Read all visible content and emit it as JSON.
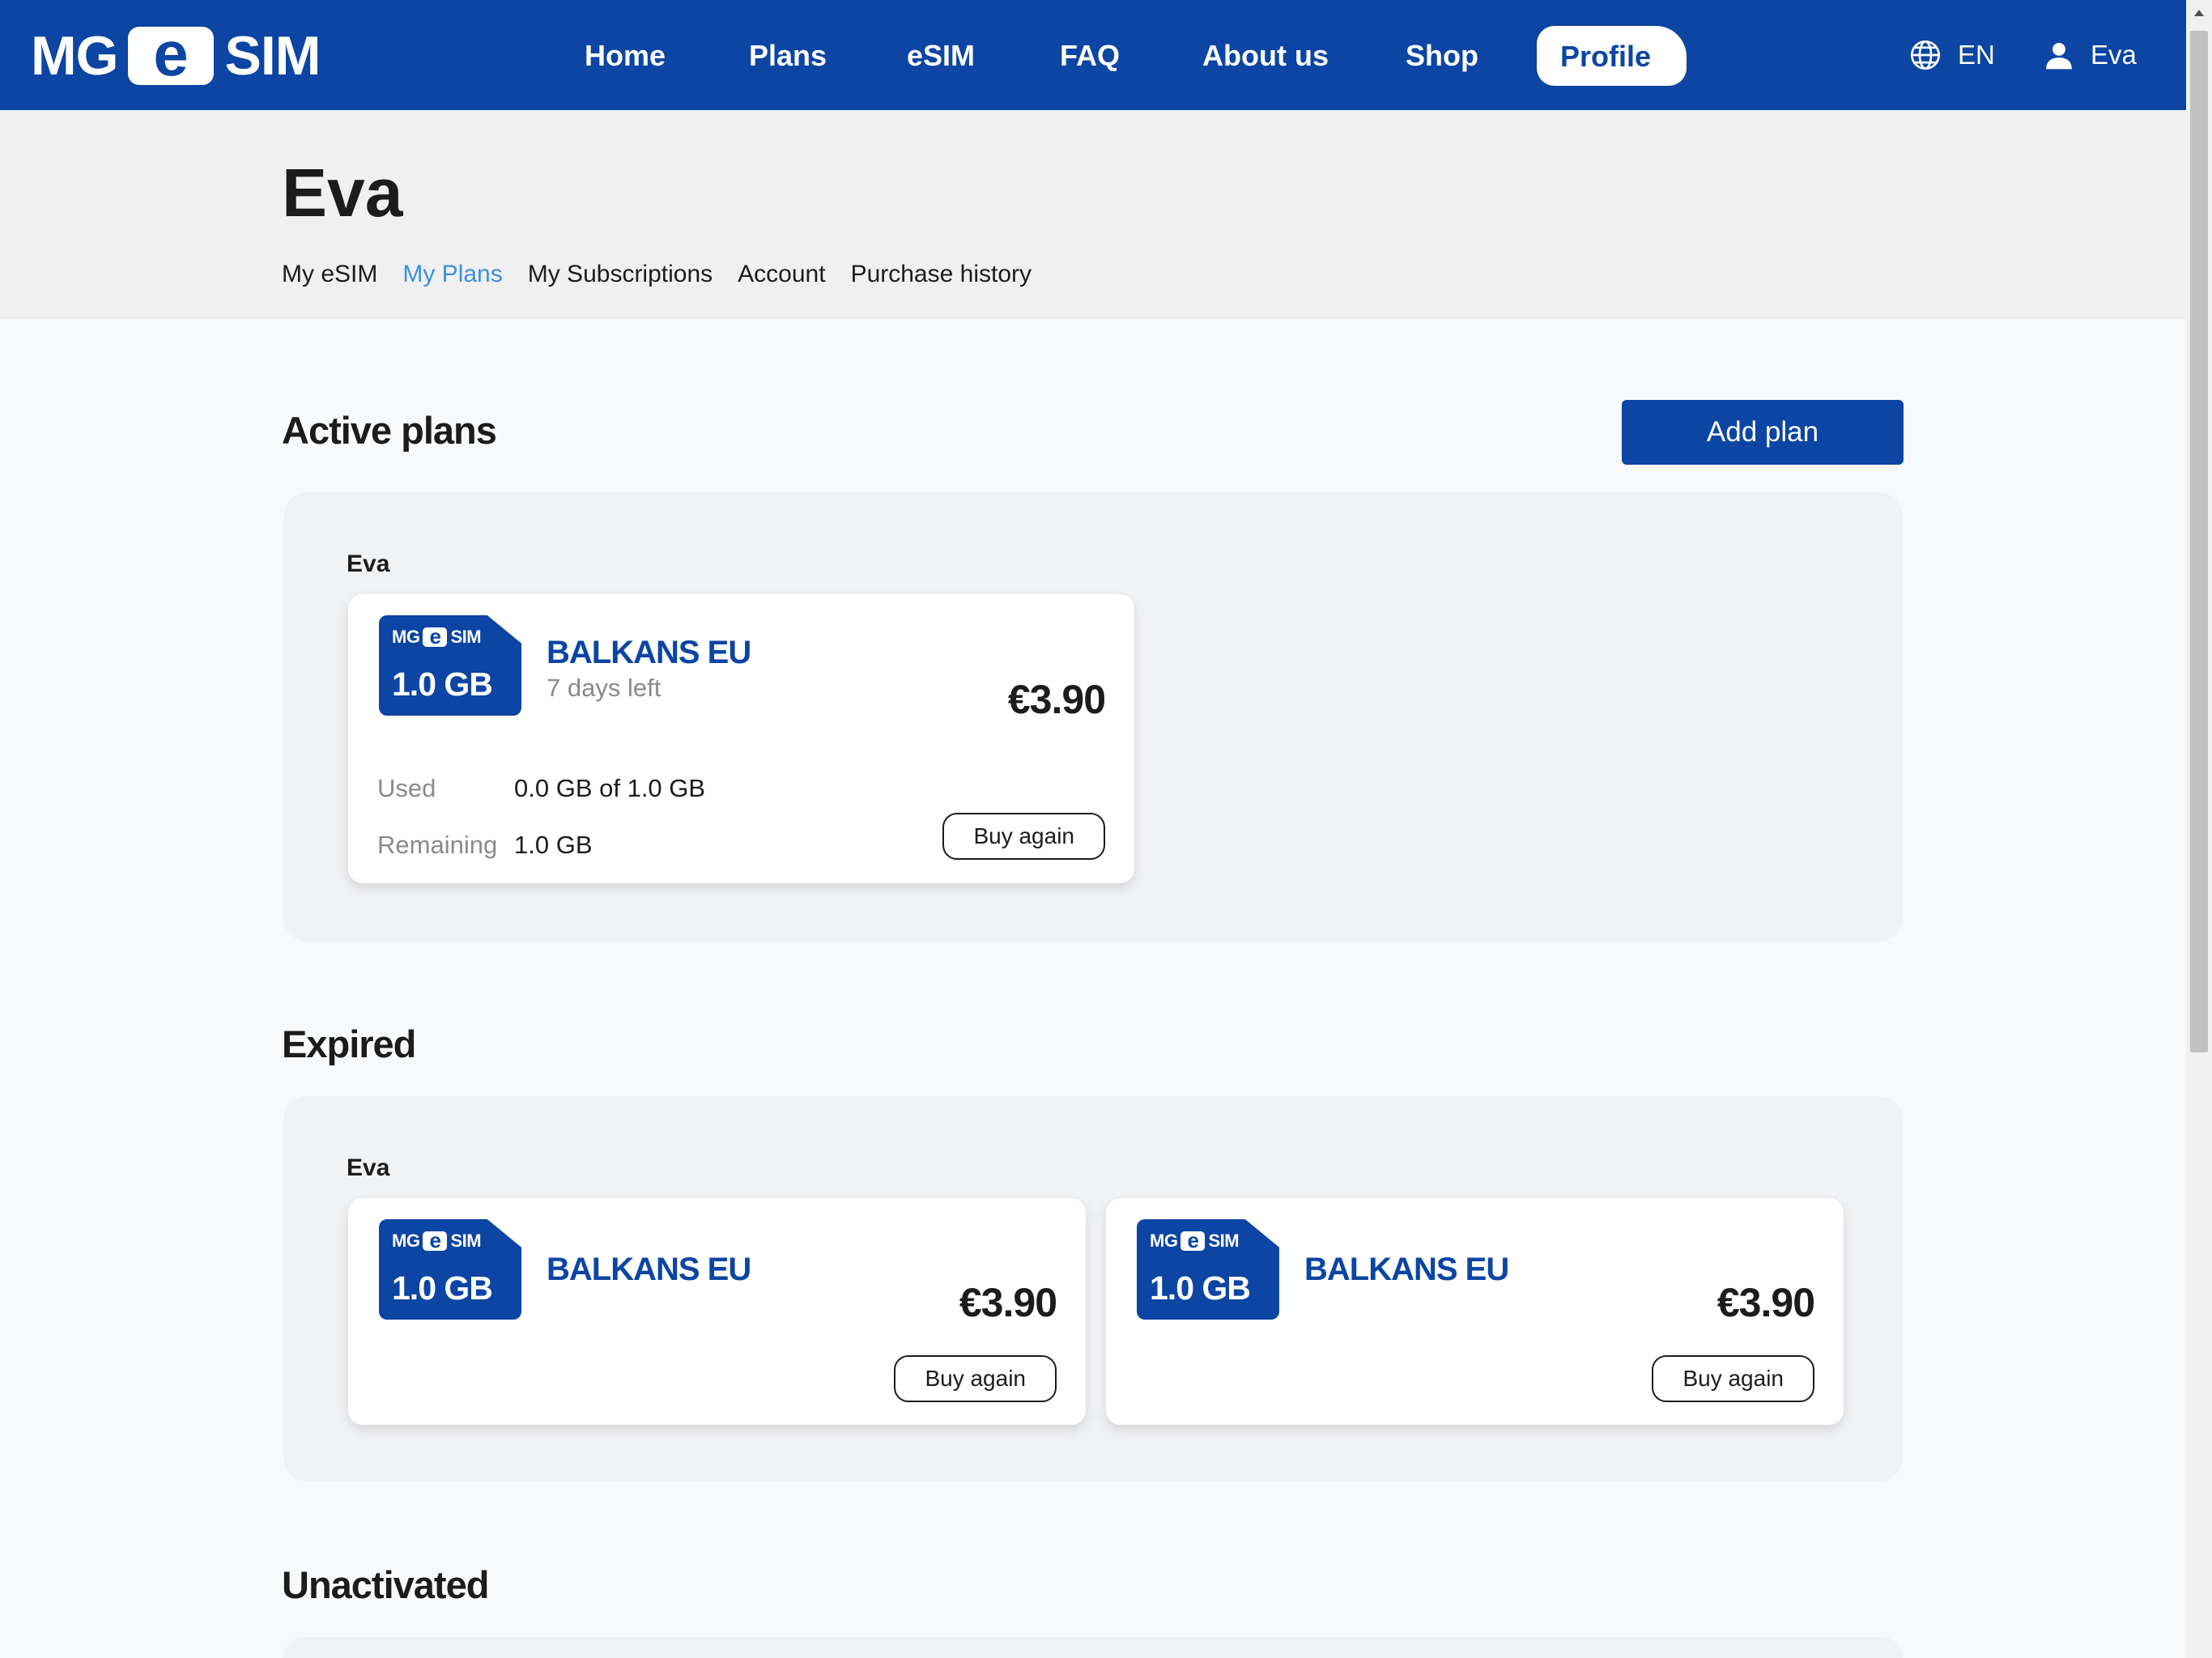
{
  "brand": {
    "logo_left": "MG",
    "logo_e": "e",
    "logo_right": "SIM"
  },
  "nav": {
    "items": [
      {
        "label": "Home"
      },
      {
        "label": "Plans"
      },
      {
        "label": "eSIM"
      },
      {
        "label": "FAQ"
      },
      {
        "label": "About us"
      },
      {
        "label": "Shop"
      },
      {
        "label": "Profile"
      }
    ],
    "active": "Profile",
    "language": "EN",
    "user": "Eva"
  },
  "profile": {
    "name": "Eva",
    "tabs": [
      {
        "label": "My eSIM"
      },
      {
        "label": "My Plans"
      },
      {
        "label": "My Subscriptions"
      },
      {
        "label": "Account"
      },
      {
        "label": "Purchase history"
      }
    ],
    "active_tab": "My Plans"
  },
  "active_section": {
    "title": "Active plans",
    "add_button": "Add plan",
    "owner": "Eva",
    "plans": [
      {
        "sim_data": "1.0 GB",
        "name": "BALKANS EU",
        "days_left": "7 days left",
        "price": "€3.90",
        "used_label": "Used",
        "used_value": "0.0 GB of 1.0 GB",
        "remaining_label": "Remaining",
        "remaining_value": "1.0 GB",
        "buy_label": "Buy again"
      }
    ]
  },
  "expired_section": {
    "title": "Expired",
    "owner": "Eva",
    "plans": [
      {
        "sim_data": "1.0 GB",
        "name": "BALKANS EU",
        "price": "€3.90",
        "buy_label": "Buy again"
      },
      {
        "sim_data": "1.0 GB",
        "name": "BALKANS EU",
        "price": "€3.90",
        "buy_label": "Buy again"
      }
    ]
  },
  "unactivated_section": {
    "title": "Unactivated"
  },
  "colors": {
    "brand_blue": "#0c45a3",
    "active_tab": "#3d8fe0",
    "background": "#f8f9fa"
  },
  "icons": {
    "language": "globe-icon",
    "user": "user-icon"
  }
}
